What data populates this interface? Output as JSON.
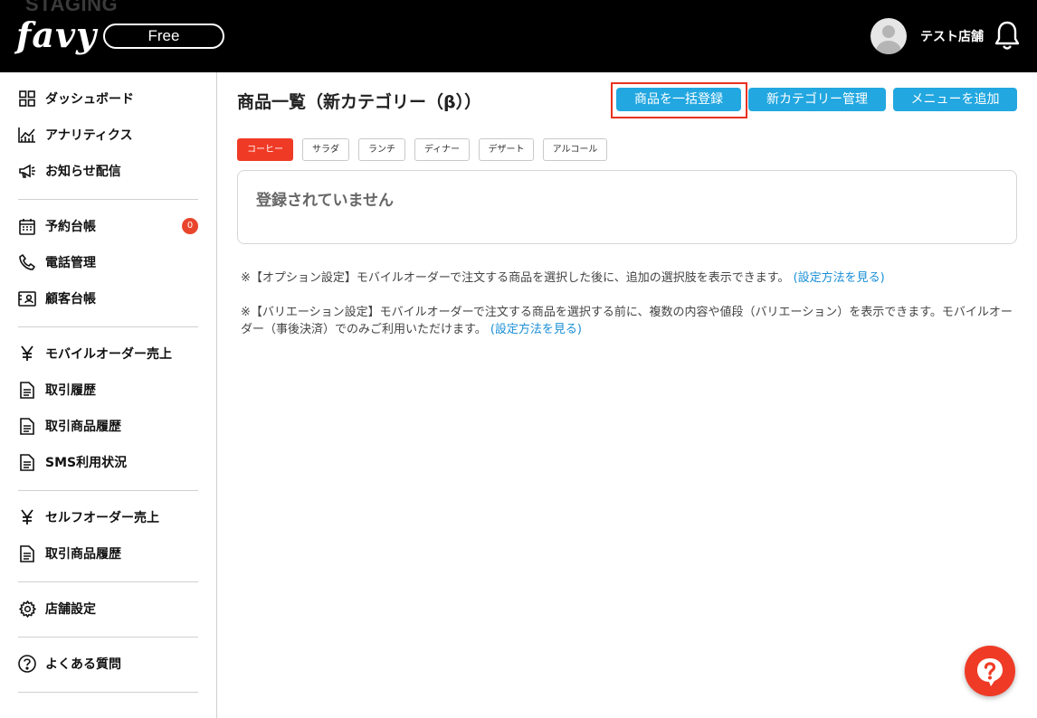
{
  "header": {
    "environment_label": "STAGING",
    "logo_text": "favy",
    "plan_badge": "Free",
    "shop_name": "テスト店舗"
  },
  "sidebar": {
    "items": [
      {
        "label": "ダッシュボード",
        "icon": "grid-icon"
      },
      {
        "label": "アナリティクス",
        "icon": "chart-line-icon"
      },
      {
        "label": "お知らせ配信",
        "icon": "megaphone-icon"
      },
      {
        "label": "予約台帳",
        "icon": "calendar-icon",
        "badge": "0"
      },
      {
        "label": "電話管理",
        "icon": "phone-icon"
      },
      {
        "label": "顧客台帳",
        "icon": "contact-card-icon"
      },
      {
        "label": "モバイルオーダー売上",
        "icon": "yen-icon"
      },
      {
        "label": "取引履歴",
        "icon": "document-icon"
      },
      {
        "label": "取引商品履歴",
        "icon": "document-icon"
      },
      {
        "label": "SMS利用状況",
        "icon": "document-icon"
      },
      {
        "label": "セルフオーダー売上",
        "icon": "yen-icon"
      },
      {
        "label": "取引商品履歴",
        "icon": "document-icon"
      },
      {
        "label": "店舗設定",
        "icon": "gear-icon"
      },
      {
        "label": "よくある質問",
        "icon": "question-circle-icon"
      }
    ]
  },
  "main": {
    "title": "商品一覧（新カテゴリー（β））",
    "buttons": {
      "bulk_register": "商品を一括登録",
      "category_manage": "新カテゴリー管理",
      "add_menu": "メニューを追加"
    },
    "category_tabs": [
      {
        "label": "コーヒー",
        "active": true
      },
      {
        "label": "サラダ",
        "active": false
      },
      {
        "label": "ランチ",
        "active": false
      },
      {
        "label": "ディナー",
        "active": false
      },
      {
        "label": "デザート",
        "active": false
      },
      {
        "label": "アルコール",
        "active": false
      }
    ],
    "empty_message": "登録されていません",
    "notes": [
      {
        "text": "※【オプション設定】モバイルオーダーで注文する商品を選択した後に、追加の選択肢を表示できます。",
        "link": "(設定方法を見る)"
      },
      {
        "text": "※【バリエーション設定】モバイルオーダーで注文する商品を選択する前に、複数の内容や値段（バリエーション）を表示できます。モバイルオーダー（事後決済）でのみご利用いただけます。",
        "link": "(設定方法を見る)"
      }
    ]
  },
  "colors": {
    "header_bg": "#000000",
    "primary_button": "#22a7e0",
    "active_tab": "#ef3b26",
    "highlight": "#e8321f",
    "link": "#1a8fd6"
  }
}
